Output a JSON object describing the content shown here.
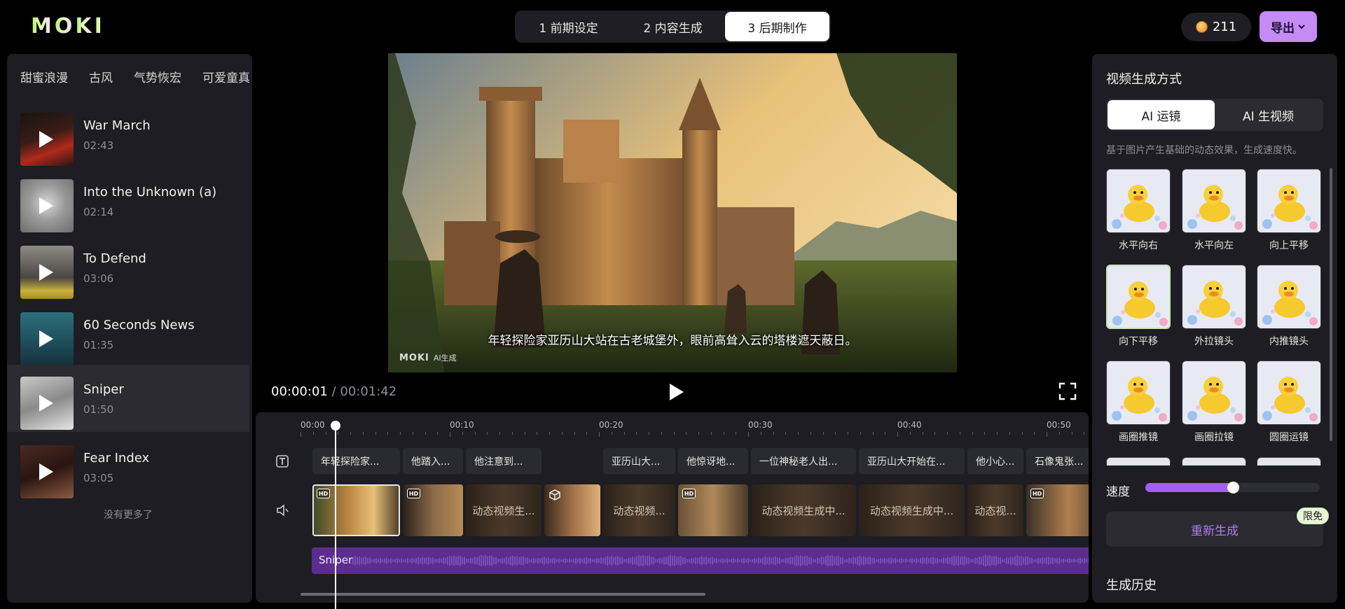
{
  "header": {
    "logo_text": "MOKI",
    "steps": [
      "1 前期设定",
      "2 内容生成",
      "3 后期制作"
    ],
    "active_step": 2,
    "coins": "211",
    "export_label": "导出"
  },
  "left": {
    "categories": [
      "甜蜜浪漫",
      "古风",
      "气势恢宏",
      "可爱童真"
    ],
    "music": [
      {
        "title": "War March",
        "duration": "02:43"
      },
      {
        "title": "Into the Unknown (a)",
        "duration": "02:14"
      },
      {
        "title": "To Defend",
        "duration": "03:06"
      },
      {
        "title": "60 Seconds News",
        "duration": "01:35"
      },
      {
        "title": "Sniper",
        "duration": "01:50"
      },
      {
        "title": "Fear Index",
        "duration": "03:05"
      }
    ],
    "no_more": "没有更多了"
  },
  "preview": {
    "subtitle": "年轻探险家亚历山大站在古老城堡外，眼前高耸入云的塔楼遮天蔽日。",
    "watermark_logo": "MOKI",
    "watermark_text": "AI生成",
    "time_current": "00:00:01",
    "time_total": "/ 00:01:42"
  },
  "timeline": {
    "ruler": [
      "00:00",
      "00:10",
      "00:20",
      "00:30",
      "00:40",
      "00:50"
    ],
    "text_clips": [
      "年轻探险家...",
      "他踏入...",
      "他注意到...",
      "亚历山大...",
      "他惊讶地...",
      "一位神秘老人出...",
      "亚历山大开始在...",
      "他小心...",
      "石像鬼张..."
    ],
    "video_clips": [
      "",
      "",
      "动态视频生...",
      "",
      "动态视频...",
      "",
      "动态视频生成中...",
      "动态视频生成中...",
      "动态视...",
      ""
    ],
    "audio_label": "Sniper"
  },
  "right": {
    "title": "视频生成方式",
    "modes": [
      "AI 运镜",
      "AI 生视频"
    ],
    "active_mode": 0,
    "description": "基于图片产生基础的动态效果，生成速度快。",
    "effects": [
      "水平向右",
      "水平向左",
      "向上平移",
      "向下平移",
      "外拉镜头",
      "内推镜头",
      "画圈推镜",
      "画圈拉镜",
      "圆圈运镜"
    ],
    "selected_effect": 3,
    "speed_label": "速度",
    "speed_value": 0.5,
    "regen_label": "重新生成",
    "limit_badge": "限免",
    "history_label": "生成历史"
  },
  "colors": {
    "accent": "#c48bf7",
    "audio": "#5a2d8f",
    "panel": "#1d1d23"
  }
}
